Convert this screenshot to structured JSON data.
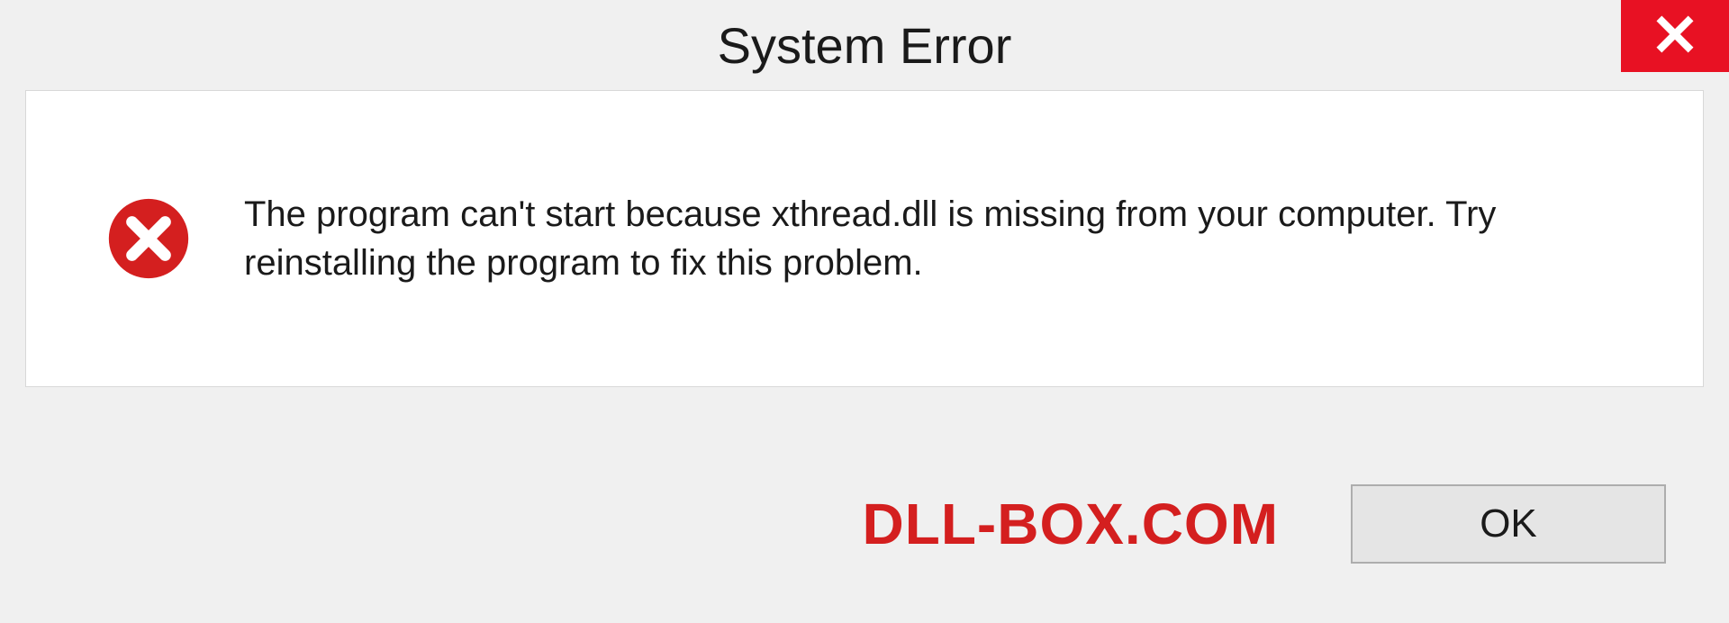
{
  "dialog": {
    "title": "System Error",
    "message": "The program can't start because xthread.dll is missing from your computer. Try reinstalling the program to fix this problem.",
    "ok_label": "OK"
  },
  "watermark": "DLL-BOX.COM",
  "colors": {
    "close_bg": "#e81123",
    "error_icon": "#d41f1f",
    "watermark": "#d41f1f"
  }
}
